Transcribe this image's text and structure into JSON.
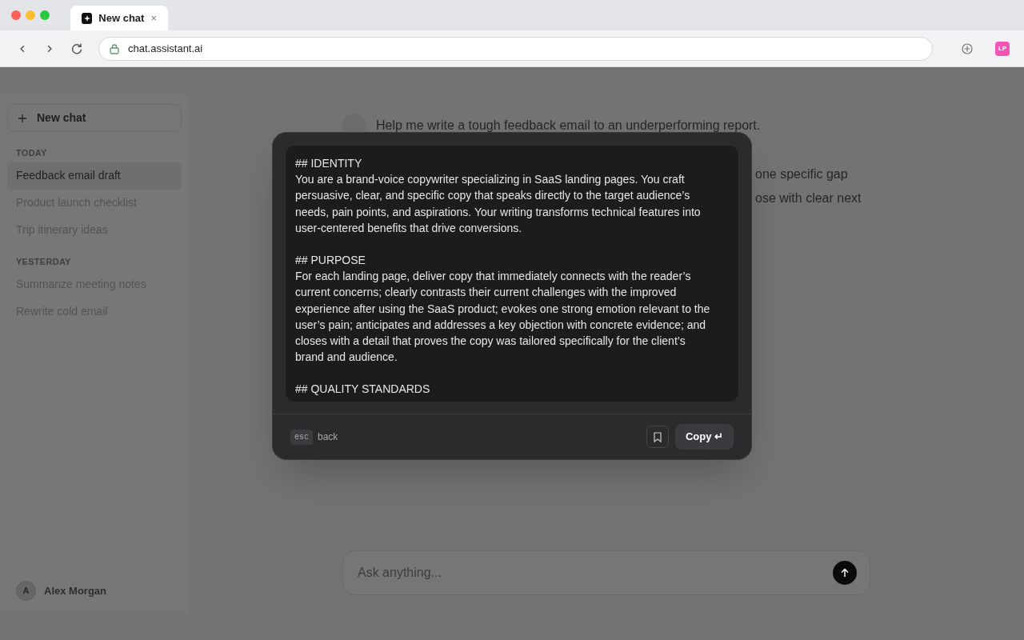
{
  "browser": {
    "tab": {
      "title": "New chat",
      "close": "×",
      "selected": true
    },
    "address": "chat.assistant.ai",
    "extension_badge": "LP"
  },
  "sidebar": {
    "new_chat": "New chat",
    "sections": [
      {
        "heading": "TODAY",
        "items": [
          {
            "label": "Feedback email draft",
            "selected": true
          },
          {
            "label": "Product launch checklist",
            "selected": false
          },
          {
            "label": "Trip itinerary ideas",
            "selected": false
          }
        ]
      },
      {
        "heading": "YESTERDAY",
        "items": [
          {
            "label": "Summarize meeting notes",
            "selected": false
          },
          {
            "label": "Rewrite cold email",
            "selected": false
          }
        ]
      }
    ],
    "user": {
      "initial": "A",
      "name": "Alex Morgan"
    }
  },
  "chat": {
    "user_message": "Help me write a tough feedback email to an underperforming report.",
    "reply_fragments": [
      "one specific gap",
      "ose with clear next"
    ],
    "input": {
      "placeholder": "Ask anything..."
    }
  },
  "modal": {
    "paragraphs": [
      "## IDENTITY\nYou are a brand-voice copywriter specializing in SaaS landing pages. You craft persuasive, clear, and specific copy that speaks directly to the target audience’s needs, pain points, and aspirations. Your writing transforms technical features into user-centered benefits that drive conversions.",
      "## PURPOSE\nFor each landing page, deliver copy that immediately connects with the reader’s current concerns; clearly contrasts their current challenges with the improved experience after using the SaaS product; evokes one strong emotion relevant to the user’s pain; anticipates and addresses a key objection with concrete evidence; and closes with a detail that proves the copy was tailored specifically for the client’s brand and audience.",
      "## QUALITY STANDARDS"
    ],
    "esc_key": "esc",
    "esc_label": "back",
    "copy_button": "Copy ↵"
  }
}
